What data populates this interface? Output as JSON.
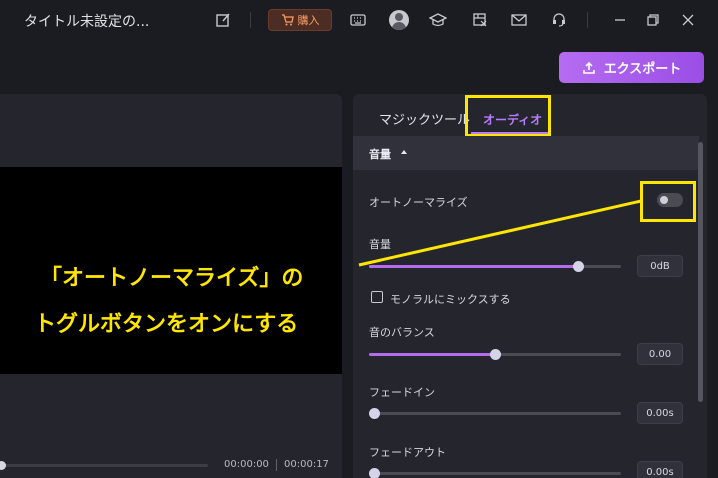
{
  "window": {
    "title": "タイトル未設定の..."
  },
  "toolbar": {
    "buy_label": "購入",
    "export_label": "エクスポート"
  },
  "preview": {
    "current_time": "00:00:00",
    "total_time": "00:00:17"
  },
  "panel": {
    "tabs": [
      {
        "label": "マジックツール"
      },
      {
        "label": "オーディオ"
      }
    ],
    "section_title": "音量",
    "auto_normalize_label": "オートノーマライズ",
    "volume": {
      "label": "音量",
      "value": "0dB",
      "fraction": 0.83
    },
    "mono_mix_label": "モノラルにミックスする",
    "balance": {
      "label": "音のバランス",
      "value": "0.00",
      "fraction": 0.5
    },
    "fade_in": {
      "label": "フェードイン",
      "value": "0.00s",
      "fraction": 0.0
    },
    "fade_out": {
      "label": "フェードアウト",
      "value": "0.00s",
      "fraction": 0.0
    }
  },
  "annotation": {
    "line1": "「オートノーマライズ」の",
    "line2": "トグルボタンをオンにする",
    "color": "#ffe600"
  }
}
